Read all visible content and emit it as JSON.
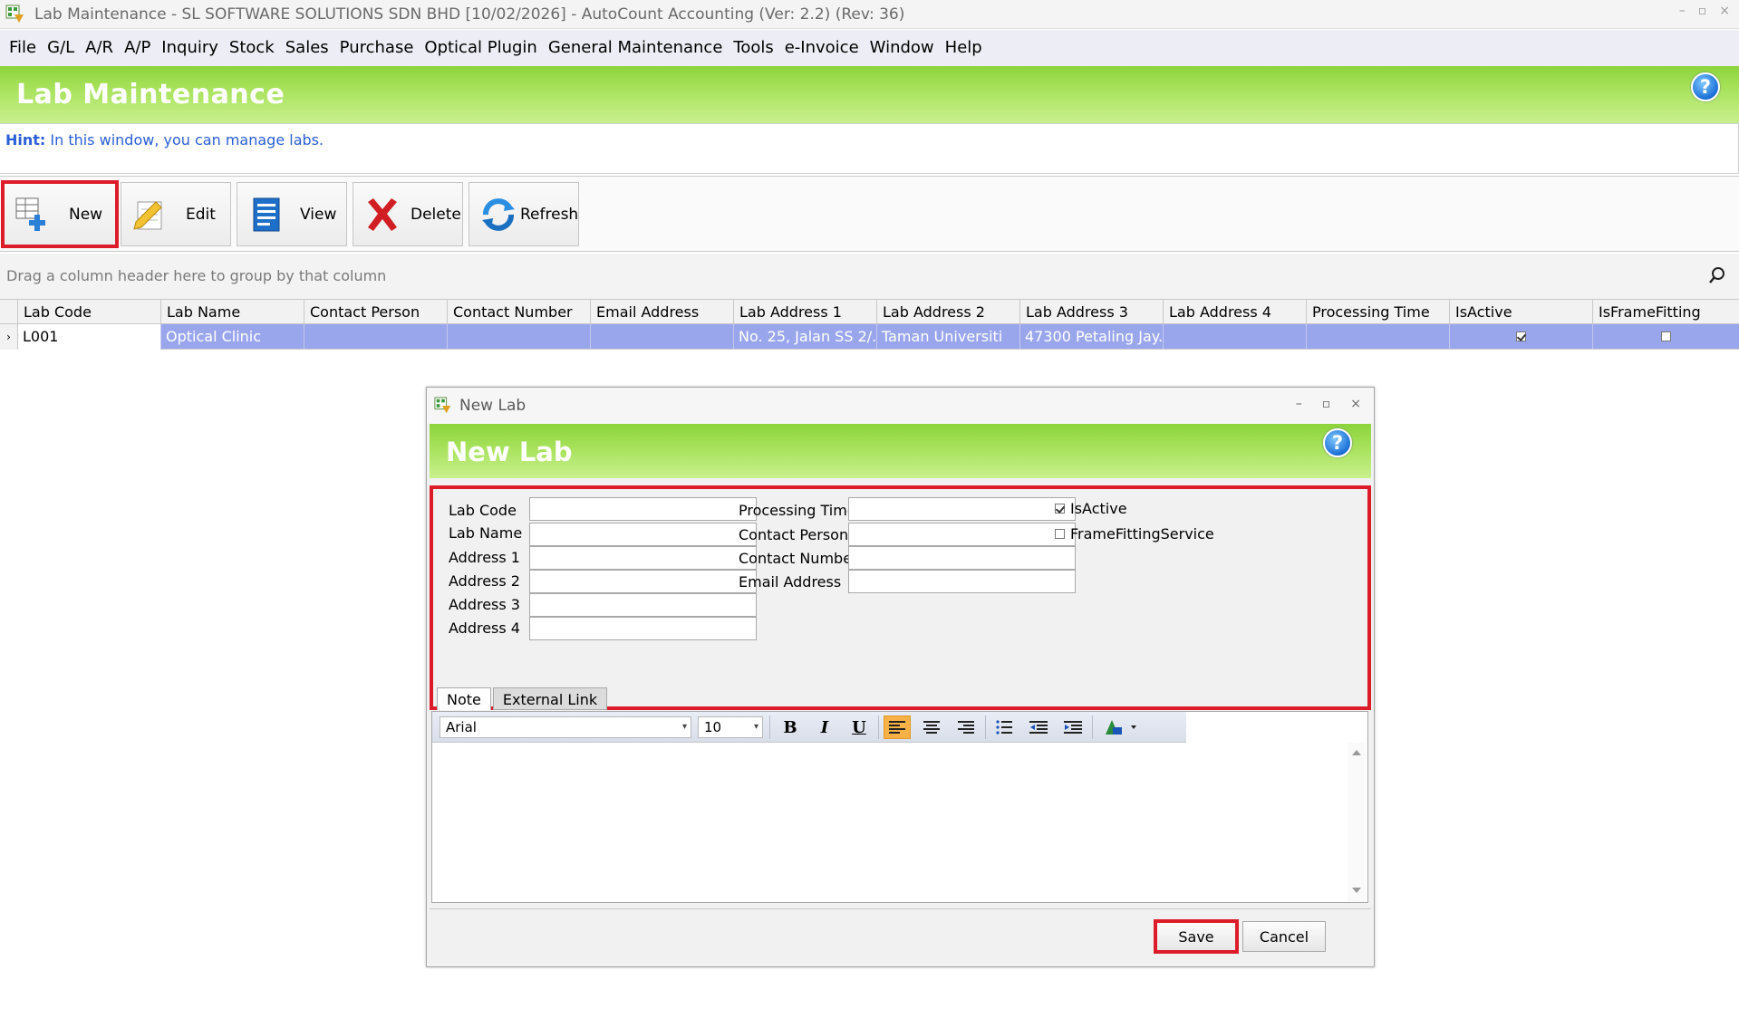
{
  "window": {
    "title": "Lab Maintenance - SL SOFTWARE SOLUTIONS SDN BHD [10/02/2026] - AutoCount Accounting (Ver: 2.2) (Rev: 36)",
    "minimize": "–",
    "restore": "▫",
    "close": "×"
  },
  "menu": [
    "File",
    "G/L",
    "A/R",
    "A/P",
    "Inquiry",
    "Stock",
    "Sales",
    "Purchase",
    "Optical Plugin",
    "General Maintenance",
    "Tools",
    "e-Invoice",
    "Window",
    "Help"
  ],
  "banner": {
    "title": "Lab Maintenance",
    "help": "?"
  },
  "hint": {
    "label": "Hint:",
    "text": "In this window, you can manage labs."
  },
  "toolbar": {
    "new": "New",
    "edit": "Edit",
    "view": "View",
    "delete": "Delete",
    "refresh": "Refresh"
  },
  "group_hint": "Drag a column header here to group by that column",
  "grid": {
    "columns": [
      "Lab Code",
      "Lab Name",
      "Contact Person",
      "Contact Number",
      "Email Address",
      "Lab Address 1",
      "Lab Address 2",
      "Lab Address 3",
      "Lab Address 4",
      "Processing Time",
      "IsActive",
      "IsFrameFitting"
    ],
    "row": {
      "indicator": "›",
      "lab_code": "L001",
      "lab_name": "Optical Clinic",
      "contact_person": "",
      "contact_number": "",
      "email": "",
      "addr1": "No. 25, Jalan SS 2/...",
      "addr2": "Taman Universiti",
      "addr3": "47300 Petaling Jay...",
      "addr4": "",
      "processing_time": "",
      "is_active": true,
      "is_frame_fitting": false
    }
  },
  "dialog": {
    "title": "New Lab",
    "banner": "New Lab",
    "help": "?",
    "labels": {
      "lab_code": "Lab Code",
      "lab_name": "Lab Name",
      "addr1": "Address 1",
      "addr2": "Address 2",
      "addr3": "Address 3",
      "addr4": "Address 4",
      "processing_time": "Processing Time",
      "contact_person": "Contact Person",
      "contact_number": "Contact Number",
      "email": "Email Address",
      "is_active": "IsActive",
      "frame_fitting": "FrameFittingService"
    },
    "values": {
      "lab_code": "",
      "lab_name": "",
      "addr1": "",
      "addr2": "",
      "addr3": "",
      "addr4": "",
      "processing_time": "",
      "contact_person": "",
      "contact_number": "",
      "email": ""
    },
    "is_active": true,
    "frame_fitting": false,
    "tabs": [
      "Note",
      "External Link"
    ],
    "editor": {
      "font": "Arial",
      "size": "10"
    },
    "save": "Save",
    "cancel": "Cancel"
  },
  "colors": {
    "banner_green": "#8cd43c",
    "highlight_red": "#dd1c2a",
    "selected_row": "#9aa6ec",
    "hint_blue": "#2a5fd6"
  }
}
